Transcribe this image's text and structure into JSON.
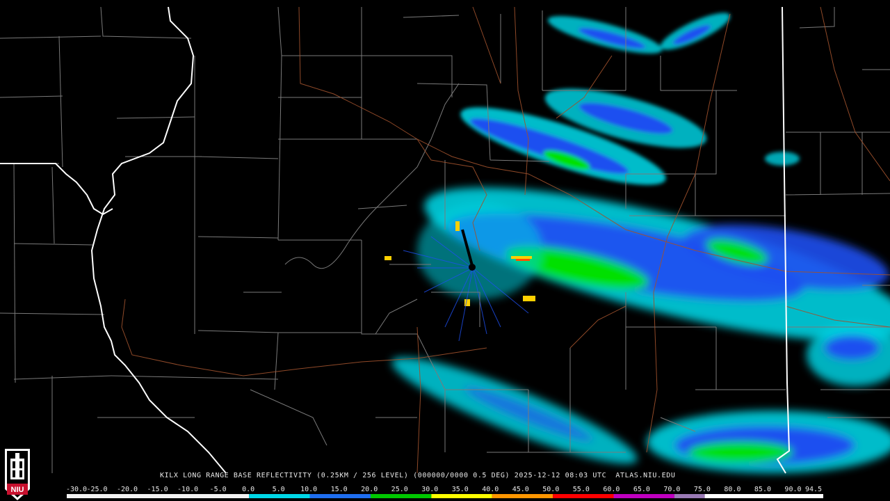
{
  "caption": "KILX LONG RANGE BASE REFLECTIVITY (0.25KM / 256 LEVEL) (000000/0000 0.5 DEG) 2025-12-12 08:03 UTC  ATLAS.NIU.EDU",
  "logo": {
    "text": "NIU",
    "name": "niu-logo"
  },
  "scale": {
    "labels": [
      "-30.0",
      "-25.0",
      "-20.0",
      "-15.0",
      "-10.0",
      "-5.0",
      "0.0",
      "5.0",
      "10.0",
      "15.0",
      "20.0",
      "25.0",
      "30.0",
      "35.0",
      "40.0",
      "45.0",
      "50.0",
      "55.0",
      "60.0",
      "65.0",
      "70.0",
      "75.0",
      "80.0",
      "85.0",
      "90.0",
      "94.5"
    ],
    "segments": [
      {
        "color": "#f2f2f2",
        "from": -30,
        "to": 0
      },
      {
        "color": "#00d8e8",
        "from": 0,
        "to": 10
      },
      {
        "color": "#1e6ef0",
        "from": 10,
        "to": 20
      },
      {
        "color": "#00c800",
        "from": 20,
        "to": 30
      },
      {
        "color": "#ffff00",
        "from": 30,
        "to": 40
      },
      {
        "color": "#ff9600",
        "from": 40,
        "to": 50
      },
      {
        "color": "#ff0000",
        "from": 50,
        "to": 60
      },
      {
        "color": "#c000c0",
        "from": 60,
        "to": 70
      },
      {
        "color": "#9a7ab5",
        "from": 70,
        "to": 75
      },
      {
        "color": "#ffffff",
        "from": 75,
        "to": 94.5
      }
    ]
  },
  "colors": {
    "county_lines": "#7a7a7a",
    "state_lines": "#ffffff",
    "highways": "#a0522d",
    "echo_light": "#00d0e0",
    "echo_mid": "#1e50f0",
    "echo_strong": "#00e000",
    "echo_heavy": "#ffd000"
  }
}
